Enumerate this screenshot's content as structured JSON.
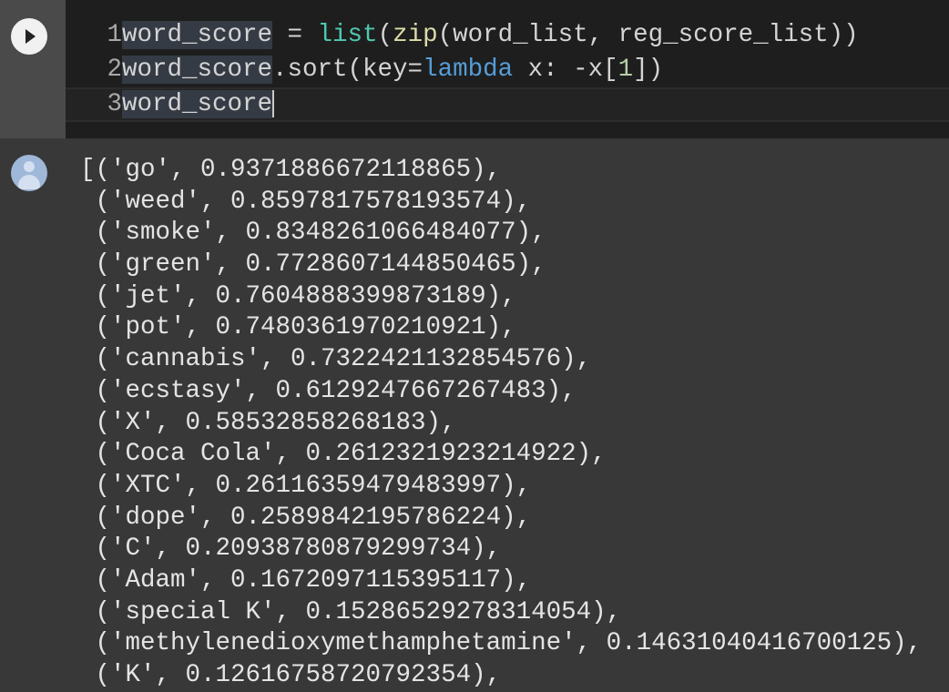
{
  "code_cell": {
    "lines": [
      {
        "num": "1",
        "tokens": [
          {
            "t": "word_score"
          },
          {
            "t": " = "
          },
          {
            "t": "list"
          },
          {
            "t": "("
          },
          {
            "t": "zip"
          },
          {
            "t": "(word_list, reg_score_list))"
          }
        ]
      },
      {
        "num": "2",
        "tokens": [
          {
            "t": "word_score"
          },
          {
            "t": ".sort(key="
          },
          {
            "t": "lambda"
          },
          {
            "t": " x: -x["
          },
          {
            "t": "1"
          },
          {
            "t": "])"
          }
        ]
      },
      {
        "num": "3",
        "tokens": [
          {
            "t": "word_score"
          }
        ]
      }
    ]
  },
  "output": {
    "lines": [
      "[('go', 0.9371886672118865),",
      " ('weed', 0.8597817578193574),",
      " ('smoke', 0.8348261066484077),",
      " ('green', 0.7728607144850465),",
      " ('jet', 0.7604888399873189),",
      " ('pot', 0.7480361970210921),",
      " ('cannabis', 0.7322421132854576),",
      " ('ecstasy', 0.6129247667267483),",
      " ('X', 0.58532858268183),",
      " ('Coca Cola', 0.2612321923214922),",
      " ('XTC', 0.26116359479483997),",
      " ('dope', 0.2589842195786224),",
      " ('C', 0.20938780879299734),",
      " ('Adam', 0.1672097115395117),",
      " ('special K', 0.15286529278314054),",
      " ('methylenedioxymethamphetamine', 0.14631040416700125),",
      " ('K', 0.12616758720792354),"
    ]
  },
  "colors": {
    "builtin": "#4ec9b0",
    "function": "#dcdcaa",
    "keyword": "#569cd6",
    "number": "#b5cea8"
  }
}
